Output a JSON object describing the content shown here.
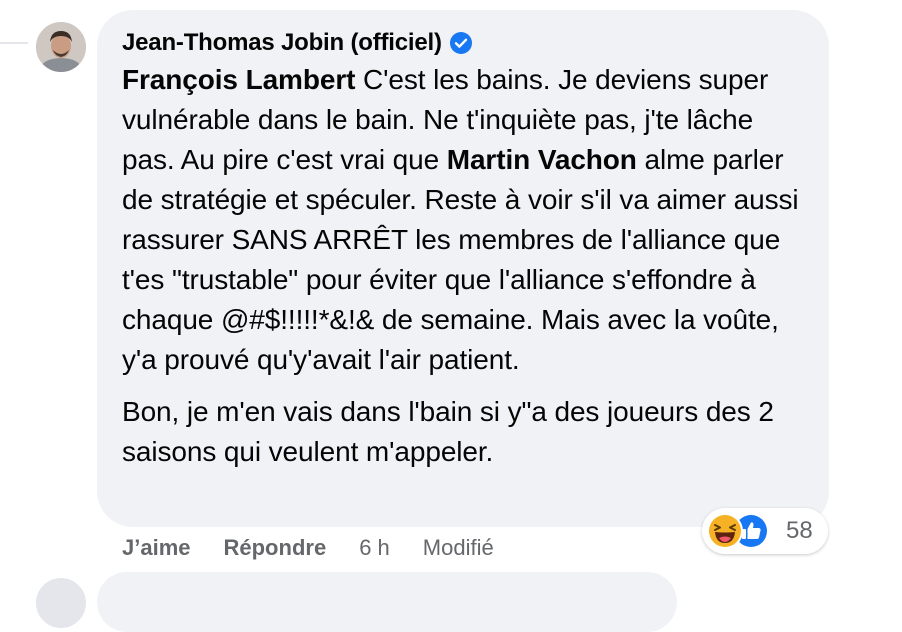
{
  "comment": {
    "author": "Jean-Thomas Jobin (officiel)",
    "verified": true,
    "paragraph1": {
      "mention1": "François Lambert",
      "text1": " C'est les bains. Je deviens super vulnérable dans le bain. Ne t'inquiète pas, j'te lâche pas. Au pire c'est vrai que ",
      "mention2": "Martin Vachon",
      "text2": " alme parler de stratégie et spéculer. Reste à voir s'il va aimer aussi rassurer SANS ARRÊT les membres de l'alliance que t'es \"trustable\" pour éviter que l'alliance s'effondre à chaque @#$!!!!!*&!& de semaine. Mais avec la voûte, y'a prouvé qu'y'avait l'air patient."
    },
    "paragraph2": "Bon, je m'en vais dans l'bain si y\"a des joueurs des 2 saisons qui veulent m'appeler."
  },
  "actions": {
    "like_label": "J’aime",
    "reply_label": "Répondre",
    "time": "6 h",
    "edited": "Modifié"
  },
  "reactions": {
    "icons": [
      "haha-icon",
      "like-icon"
    ],
    "count": "58"
  },
  "colors": {
    "bubble": "#f0f2f5",
    "secondary_text": "#65676b",
    "verified_blue": "#1877f2",
    "haha_yellow": "#f7b125"
  }
}
